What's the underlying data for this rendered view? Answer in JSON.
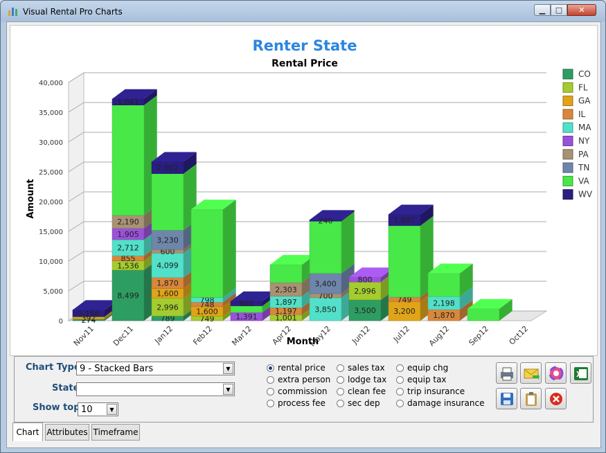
{
  "window": {
    "title": "Visual Rental Pro Charts",
    "min": "▁",
    "max": "□",
    "close": "✕"
  },
  "chart": {
    "heading": "Renter State",
    "subtitle": "Rental Price",
    "xlabel": "Month",
    "ylabel": "Amount"
  },
  "colors": {
    "CO": "#2e9d62",
    "FL": "#a4cc2e",
    "GA": "#e0a418",
    "IL": "#d8873c",
    "MA": "#52e0c8",
    "NY": "#9a52d8",
    "PA": "#a89274",
    "TN": "#6e86aa",
    "VA": "#48e848",
    "WV": "#2a1e82",
    "heading": "#2a86e0"
  },
  "chart_data": {
    "type": "bar",
    "stacked": true,
    "title": "Rental Price",
    "xlabel": "Month",
    "ylabel": "Amount",
    "ylim": [
      0,
      40000
    ],
    "yticks": [
      "0",
      "5,000",
      "10,000",
      "15,000",
      "20,000",
      "25,000",
      "30,000",
      "35,000",
      "40,000"
    ],
    "categories": [
      "Nov11",
      "Dec11",
      "Jan12",
      "Feb12",
      "Mar12",
      "Apr12",
      "May12",
      "Jun12",
      "Jul12",
      "Aug12",
      "Sep12",
      "Oct12"
    ],
    "legend_position": "right",
    "series": [
      {
        "name": "CO",
        "values": [
          274,
          8499,
          789,
          0,
          0,
          0,
          0,
          3500,
          0,
          0,
          0,
          0
        ]
      },
      {
        "name": "FL",
        "values": [
          0,
          1536,
          2996,
          749,
          0,
          1001,
          0,
          2996,
          0,
          0,
          0,
          0
        ]
      },
      {
        "name": "GA",
        "values": [
          392,
          0,
          1600,
          1600,
          0,
          0,
          0,
          0,
          3200,
          0,
          0,
          0
        ]
      },
      {
        "name": "IL",
        "values": [
          0,
          855,
          1870,
          748,
          0,
          1197,
          0,
          0,
          749,
          1870,
          0,
          0
        ]
      },
      {
        "name": "MA",
        "values": [
          0,
          2712,
          4099,
          798,
          0,
          1897,
          3850,
          0,
          0,
          2198,
          0,
          0
        ]
      },
      {
        "name": "NY",
        "values": [
          0,
          1905,
          0,
          0,
          1391,
          0,
          0,
          800,
          0,
          0,
          0,
          0
        ]
      },
      {
        "name": "PA",
        "values": [
          0,
          2190,
          600,
          0,
          0,
          2303,
          700,
          0,
          0,
          0,
          0,
          0
        ]
      },
      {
        "name": "TN",
        "values": [
          0,
          0,
          3230,
          0,
          0,
          0,
          3400,
          0,
          0,
          0,
          0,
          0
        ]
      },
      {
        "name": "VA",
        "values": [
          0,
          18500,
          9500,
          14800,
          1100,
          3000,
          8750,
          0,
          12000,
          3900,
          2000,
          0
        ]
      },
      {
        "name": "WV",
        "values": [
          1156,
          1041,
          2002,
          0,
          801,
          0,
          240,
          0,
          1897,
          0,
          0,
          0
        ]
      }
    ],
    "data_labels": [
      {
        "cat": 1,
        "series": "CO",
        "text": "8,499"
      },
      {
        "cat": 1,
        "series": "FL",
        "text": "1,536"
      },
      {
        "cat": 1,
        "series": "IL",
        "text": "855"
      },
      {
        "cat": 1,
        "series": "MA",
        "text": "2,712"
      },
      {
        "cat": 1,
        "series": "NY",
        "text": "1,905"
      },
      {
        "cat": 1,
        "series": "PA",
        "text": "2,190"
      },
      {
        "cat": 1,
        "series": "WV",
        "text": "1,041"
      },
      {
        "cat": 2,
        "series": "CO",
        "text": "789"
      },
      {
        "cat": 2,
        "series": "FL",
        "text": "2,996"
      },
      {
        "cat": 2,
        "series": "GA",
        "text": "1,600"
      },
      {
        "cat": 2,
        "series": "IL",
        "text": "1,870"
      },
      {
        "cat": 2,
        "series": "MA",
        "text": "4,099"
      },
      {
        "cat": 2,
        "series": "PA",
        "text": "600"
      },
      {
        "cat": 2,
        "series": "TN",
        "text": "3,230"
      },
      {
        "cat": 2,
        "series": "WV",
        "text": "2,002"
      },
      {
        "cat": 3,
        "series": "FL",
        "text": "749"
      },
      {
        "cat": 3,
        "series": "GA",
        "text": "1,600"
      },
      {
        "cat": 3,
        "series": "IL",
        "text": "748"
      },
      {
        "cat": 3,
        "series": "MA",
        "text": "798"
      },
      {
        "cat": 4,
        "series": "NY",
        "text": "1,391"
      },
      {
        "cat": 4,
        "series": "WV",
        "text": "801"
      },
      {
        "cat": 5,
        "series": "FL",
        "text": "1,001"
      },
      {
        "cat": 5,
        "series": "IL",
        "text": "1,197"
      },
      {
        "cat": 5,
        "series": "MA",
        "text": "1,897"
      },
      {
        "cat": 5,
        "series": "PA",
        "text": "2,303"
      },
      {
        "cat": 6,
        "series": "MA",
        "text": "3,850"
      },
      {
        "cat": 6,
        "series": "PA",
        "text": "700"
      },
      {
        "cat": 6,
        "series": "TN",
        "text": "3,400"
      },
      {
        "cat": 6,
        "series": "WV",
        "text": "240"
      },
      {
        "cat": 7,
        "series": "CO",
        "text": "3,500"
      },
      {
        "cat": 7,
        "series": "FL",
        "text": "2,996"
      },
      {
        "cat": 7,
        "series": "NY",
        "text": "800"
      },
      {
        "cat": 8,
        "series": "GA",
        "text": "3,200"
      },
      {
        "cat": 8,
        "series": "IL",
        "text": "749"
      },
      {
        "cat": 8,
        "series": "WV",
        "text": "1,897"
      },
      {
        "cat": 9,
        "series": "IL",
        "text": "1,870"
      },
      {
        "cat": 9,
        "series": "MA",
        "text": "2,198"
      },
      {
        "cat": 0,
        "series": "CO",
        "text": "274"
      },
      {
        "cat": 0,
        "series": "GA",
        "text": "392"
      },
      {
        "cat": 0,
        "series": "WV",
        "text": "1,156"
      }
    ]
  },
  "controls": {
    "chart_type_label": "Chart Type",
    "chart_type_value": "9 - Stacked Bars",
    "state_label": "State",
    "state_value": "",
    "show_top_label": "Show top",
    "show_top_value": "10",
    "radios": [
      {
        "label": "rental price",
        "checked": true
      },
      {
        "label": "extra person",
        "checked": false
      },
      {
        "label": "commission",
        "checked": false
      },
      {
        "label": "process fee",
        "checked": false
      },
      {
        "label": "sales tax",
        "checked": false
      },
      {
        "label": "lodge tax",
        "checked": false
      },
      {
        "label": "clean fee",
        "checked": false
      },
      {
        "label": "sec dep",
        "checked": false
      },
      {
        "label": "equip chg",
        "checked": false
      },
      {
        "label": "equip tax",
        "checked": false
      },
      {
        "label": "trip insurance",
        "checked": false
      },
      {
        "label": "damage insurance",
        "checked": false
      }
    ],
    "toolbar": [
      "print-icon",
      "email-icon",
      "color-palette-icon",
      "excel-icon",
      "save-icon",
      "clipboard-icon",
      "cancel-icon"
    ]
  },
  "tabs": [
    "Chart",
    "Attributes",
    "Timeframe"
  ]
}
